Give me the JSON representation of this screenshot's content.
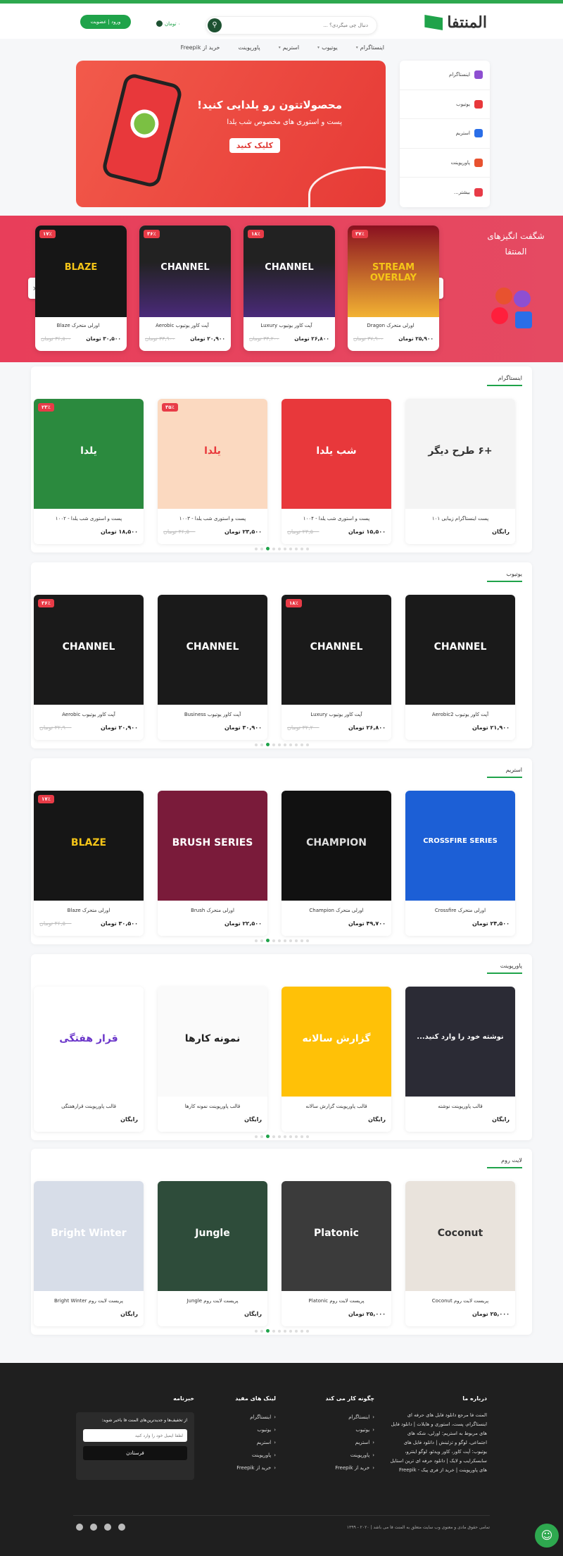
{
  "header": {
    "logo_text": "المنتفا",
    "search_placeholder": "دنبال چی میگردی؟ ...",
    "cart_label": "۰ تومان",
    "login_label": "ورود | عضویت"
  },
  "nav": [
    {
      "label": "اینستاگرام",
      "caret": true
    },
    {
      "label": "یوتیوب",
      "caret": true
    },
    {
      "label": "استریم",
      "caret": true
    },
    {
      "label": "پاورپوینت",
      "caret": false
    },
    {
      "label": "خرید از Freepik",
      "caret": false
    }
  ],
  "side": [
    "اینستاگرام",
    "یوتیوب",
    "استریم",
    "پاورپوینت",
    "بیشتر..."
  ],
  "hero": {
    "title": "محصولاتتون رو یلدایی کنید!",
    "subtitle": "پست و استوری های مخصوص شب یلدا",
    "button": "کلیک کنید"
  },
  "band": {
    "title": "شگفت انگیزهای المنتفا",
    "prev": "‹",
    "next": "›",
    "cards": [
      {
        "title": "اورلی متحرک Dragon",
        "price": "۲۵,۹۰۰ تومان",
        "old": "۳۷,۹۰۰ تومان",
        "badge": "۳۷٪",
        "img_text": "STREAM OVERLAY"
      },
      {
        "title": "آپت کاور یوتیوب Luxury",
        "price": "۲۶,۸۰۰ تومان",
        "old": "۳۳,۲۰۰ تومان",
        "badge": "۱۸٪",
        "img_text": "CHANNEL"
      },
      {
        "title": "آپت کاور یوتیوب Aerobic",
        "price": "۲۰,۹۰۰ تومان",
        "old": "۳۳,۹۰۰ تومان",
        "badge": "۳۶٪",
        "img_text": "CHANNEL"
      },
      {
        "title": "اورلی متحرک Blaze",
        "price": "۳۰,۵۰۰ تومان",
        "old": "۳۶,۵۰۰ تومان",
        "badge": "۱۷٪",
        "img_text": "BLAZE"
      }
    ]
  },
  "sections": [
    {
      "title": "اینستاگرام",
      "cards": [
        {
          "title": "پست اینستاگرام زیبایی ۱۰۱",
          "price": "رایگان",
          "old": "",
          "badge": "",
          "img_text": "+۶ طرح دیگر",
          "theme": "white"
        },
        {
          "title": "پست و استوری شب یلدا - ۱۰۰۴",
          "price": "۱۵,۵۰۰ تومان",
          "old": "۲۳,۵۰۰ تومان",
          "badge": "",
          "img_text": "شب یلدا",
          "theme": "red"
        },
        {
          "title": "پست و استوری شب یلدا - ۱۰۰۳",
          "price": "۲۳,۵۰۰ تومان",
          "old": "۳۶,۵۰۰ تومان",
          "badge": "۳۵٪",
          "img_text": "یلدا",
          "theme": "orange"
        },
        {
          "title": "پست و استوری شب یلدا - ۱۰۰۲",
          "price": "۱۸,۵۰۰ تومان",
          "old": "",
          "badge": "۲۳٪",
          "img_text": "یلدا",
          "theme": "green"
        }
      ]
    },
    {
      "title": "یوتیوب",
      "cards": [
        {
          "title": "آپت کاور یوتیوب Aerobic2",
          "price": "۲۱,۹۰۰ تومان",
          "old": "",
          "badge": "",
          "img_text": "CHANNEL",
          "theme": "ytred"
        },
        {
          "title": "آپت کاور یوتیوب Luxury",
          "price": "۲۶,۸۰۰ تومان",
          "old": "۳۲,۲۰۰ تومان",
          "badge": "۱۸٪",
          "img_text": "CHANNEL",
          "theme": "ytgold"
        },
        {
          "title": "آپت کاور یوتیوب Business",
          "price": "۳۰,۹۰۰ تومان",
          "old": "",
          "badge": "",
          "img_text": "CHANNEL",
          "theme": "ytyellow"
        },
        {
          "title": "آپت کاور یوتیوب Aerobic",
          "price": "۲۰,۹۰۰ تومان",
          "old": "۳۲,۹۰۰ تومان",
          "badge": "۳۶٪",
          "img_text": "CHANNEL",
          "theme": "ytpurple"
        }
      ]
    },
    {
      "title": "استریم",
      "cards": [
        {
          "title": "اورلی متحرک Crossfire",
          "price": "۲۴,۵۰۰ تومان",
          "old": "",
          "badge": "",
          "img_text": "CROSSFIRE SERIES",
          "theme": "blue"
        },
        {
          "title": "اورلی متحرک Champion",
          "price": "۴۹,۷۰۰ تومان",
          "old": "",
          "badge": "",
          "img_text": "CHAMPION",
          "theme": "black"
        },
        {
          "title": "اورلی متحرک Brush",
          "price": "۲۲,۵۰۰ تومان",
          "old": "",
          "badge": "",
          "img_text": "BRUSH SERIES",
          "theme": "maroon"
        },
        {
          "title": "اورلی متحرک Blaze",
          "price": "۳۰,۵۰۰ تومان",
          "old": "۳۶,۵۰۰ تومان",
          "badge": "۱۷٪",
          "img_text": "BLAZE",
          "theme": "blaze"
        }
      ]
    },
    {
      "title": "پاورپوینت",
      "cards": [
        {
          "title": "قالب پاورپوینت نوشته",
          "price": "رایگان",
          "old": "",
          "badge": "",
          "img_text": "نوشته خود را وارد کنید...",
          "theme": "dark"
        },
        {
          "title": "قالب پاورپوینت گزارش سالانه",
          "price": "رایگان",
          "old": "",
          "badge": "",
          "img_text": "گزارش سالانه",
          "theme": "yellow"
        },
        {
          "title": "قالب پاورپوینت نمونه کارها",
          "price": "رایگان",
          "old": "",
          "badge": "",
          "img_text": "نمونه کارها",
          "theme": "white2"
        },
        {
          "title": "قالب پاورپوینت قرارهفتگی",
          "price": "رایگان",
          "old": "",
          "badge": "",
          "img_text": "قرار هفتگی",
          "theme": "purpletxt"
        }
      ]
    },
    {
      "title": "لایت روم",
      "cards": [
        {
          "title": "پریست لایت روم Coconut",
          "price": "۲۵,۰۰۰ تومان",
          "old": "",
          "badge": "",
          "img_text": "Coconut",
          "theme": "beige"
        },
        {
          "title": "پریست لایت روم Platonic",
          "price": "۲۵,۰۰۰ تومان",
          "old": "",
          "badge": "",
          "img_text": "Platonic",
          "theme": "greydark"
        },
        {
          "title": "پریست لایت روم Jungle",
          "price": "رایگان",
          "old": "",
          "badge": "",
          "img_text": "Jungle",
          "theme": "jungle"
        },
        {
          "title": "پریست لایت روم Bright Winter",
          "price": "رایگان",
          "old": "",
          "badge": "",
          "img_text": "Bright Winter",
          "theme": "winter"
        }
      ]
    }
  ],
  "footer": {
    "about_title": "درباره ما",
    "about_text": "المنت فا مرجع دانلود فایل های حرفه ای اینستاگرام، پست، استوری و هایلات | دانلود فایل های مربوط به استریم: اورلی، شکه های اجتماعی، لوگو و تزئینش | دانلود فایل های یوتیوب: آپت کاور، کاور ویدئو، لوگو اینترو، سابسکرایب و لایک | دانلود حرفه ای ترین استایل های پاورپوینت | خرید از فری پیک - Freepik",
    "how_title": "چگونه کار می کند",
    "how_links": [
      "اینستاگرام",
      "یوتیوب",
      "استریم",
      "پاورپوینت",
      "خرید از Freepik"
    ],
    "useful_title": "لینک های مفید",
    "useful_links": [
      "اینستاگرام",
      "یوتیوب",
      "استریم",
      "پاورپوینت",
      "خرید از Freepik"
    ],
    "news_title": "خبرنامه",
    "news_text": "از تخفیف‌ها و جدیدترین‌های المنت فا باخبر شوید:",
    "news_placeholder": "لطفا ایمیل خود را وارد کنید",
    "news_button": "فرستادن",
    "copyright": "تمامی حقوق مادی و معنوی وب سایت متعلق به المنت فا می باشد | ۲۰۲۰ - ۱۳۹۹"
  },
  "colors": {
    "accent": "#2ea84f",
    "hero": "#e63a36",
    "band": "#e83e5a"
  }
}
